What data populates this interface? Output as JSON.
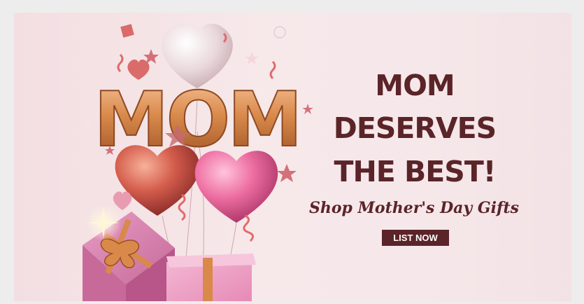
{
  "banner": {
    "headline_line1": "MOM",
    "headline_line2": "DESERVES",
    "headline_line3": "THE BEST!",
    "subtitle": "Shop Mother's Day Gifts",
    "cta_label": "LIST NOW",
    "balloon_text": "MOM"
  },
  "colors": {
    "text": "#5a2428",
    "button": "#5a2428",
    "background": "#f6e7ea",
    "gold": "#d9894a",
    "pink": "#e86a9a",
    "red": "#c9504b"
  },
  "icons": [
    "heart-balloon-icon",
    "gift-box-icon",
    "star-icon",
    "confetti-icon"
  ]
}
